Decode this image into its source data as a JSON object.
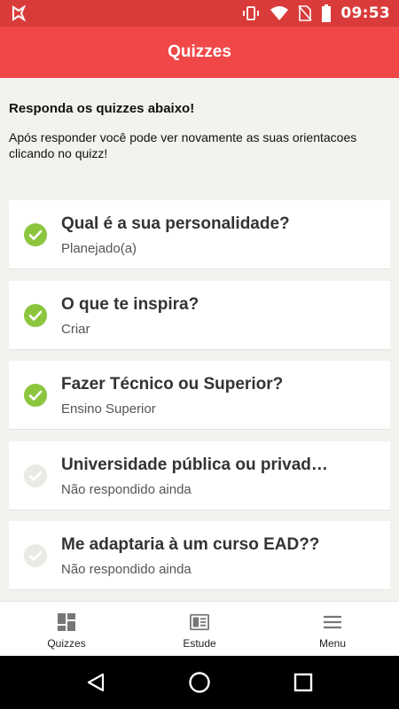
{
  "status_bar": {
    "time": "09:53",
    "icons": [
      "app-notification-icon",
      "vibrate-icon",
      "wifi-icon",
      "no-sim-icon",
      "battery-icon"
    ]
  },
  "app_bar": {
    "title": "Quizzes"
  },
  "intro": {
    "heading": "Responda os quizzes abaixo!",
    "text": "Após responder você pode ver novamente as suas orientacoes clicando no quizz!"
  },
  "quizzes": [
    {
      "title": "Qual é a sua personalidade?",
      "subtitle": "Planejado(a)",
      "answered": true
    },
    {
      "title": "O que te inspira?",
      "subtitle": "Criar",
      "answered": true
    },
    {
      "title": "Fazer Técnico ou Superior?",
      "subtitle": "Ensino Superior",
      "answered": true
    },
    {
      "title": "Universidade pública ou privad…",
      "subtitle": "Não respondido ainda",
      "answered": false
    },
    {
      "title": "Me adaptaria à um curso EAD??",
      "subtitle": "Não respondido ainda",
      "answered": false
    }
  ],
  "bottom_nav": {
    "quizzes": "Quizzes",
    "estude": "Estude",
    "menu": "Menu"
  },
  "colors": {
    "status_bar": "#d93b3b",
    "app_bar": "#f04848",
    "check_answered": "#8cc63f",
    "check_unanswered": "#ebe9e3",
    "background": "#f3f2ee"
  }
}
